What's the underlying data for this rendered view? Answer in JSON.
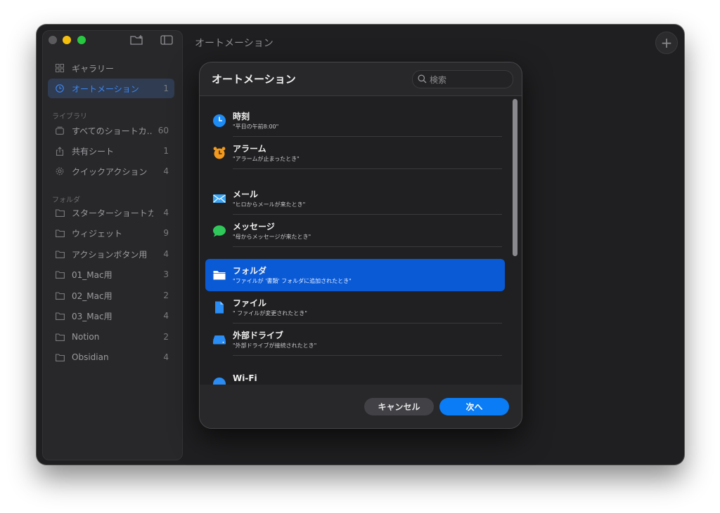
{
  "window": {
    "title": "オートメーション"
  },
  "sidebar": {
    "top_items": [
      {
        "label": "ギャラリー",
        "count": "",
        "icon": "grid-icon"
      },
      {
        "label": "オートメーション",
        "count": "1",
        "icon": "clock-icon",
        "active": true
      }
    ],
    "library_header": "ライブラリ",
    "library_items": [
      {
        "label": "すべてのショートカ…",
        "count": "60",
        "icon": "stack-icon"
      },
      {
        "label": "共有シート",
        "count": "1",
        "icon": "share-icon"
      },
      {
        "label": "クイックアクション",
        "count": "4",
        "icon": "gear-icon"
      }
    ],
    "folder_header": "フォルダ",
    "folder_items": [
      {
        "label": "スターターショートカ…",
        "count": "4"
      },
      {
        "label": "ウィジェット",
        "count": "9"
      },
      {
        "label": "アクションボタン用",
        "count": "4"
      },
      {
        "label": "01_Mac用",
        "count": "3"
      },
      {
        "label": "02_Mac用",
        "count": "2"
      },
      {
        "label": "03_Mac用",
        "count": "4"
      },
      {
        "label": "Notion",
        "count": "2"
      },
      {
        "label": "Obsidian",
        "count": "4"
      }
    ]
  },
  "dialog": {
    "title": "オートメーション",
    "search_placeholder": "検索",
    "items": [
      {
        "title": "時刻",
        "subtitle": "\"平日の午前8:00\"",
        "icon": "clock-icon",
        "color": "#1e8cf5"
      },
      {
        "title": "アラーム",
        "subtitle": "\"アラームが止まったとき\"",
        "icon": "alarm-icon",
        "color": "#f39a1e"
      },
      {
        "title": "メール",
        "subtitle": "\"ヒロからメールが来たとき\"",
        "icon": "mail-icon",
        "color": "#3aa5f5"
      },
      {
        "title": "メッセージ",
        "subtitle": "\"母からメッセージが来たとき\"",
        "icon": "message-icon",
        "color": "#30c85a"
      },
      {
        "title": "フォルダ",
        "subtitle": "\"ファイルが '書類' フォルダに追加されたとき\"",
        "icon": "folder-icon",
        "color": "#ffffff",
        "selected": true
      },
      {
        "title": "ファイル",
        "subtitle": "\" ファイルが変更されたとき\"",
        "icon": "file-icon",
        "color": "#2a8cf5"
      },
      {
        "title": "外部ドライブ",
        "subtitle": "\"外部ドライブが接続されたとき\"",
        "icon": "drive-icon",
        "color": "#2a8cf5"
      },
      {
        "title": "Wi-Fi",
        "subtitle": "",
        "icon": "wifi-icon",
        "color": "#2a8cf5"
      }
    ],
    "cancel_label": "キャンセル",
    "next_label": "次へ"
  },
  "colors": {
    "accent": "#0a7cf6",
    "selection": "#0a5ad6",
    "window_bg": "#1f1f21"
  }
}
